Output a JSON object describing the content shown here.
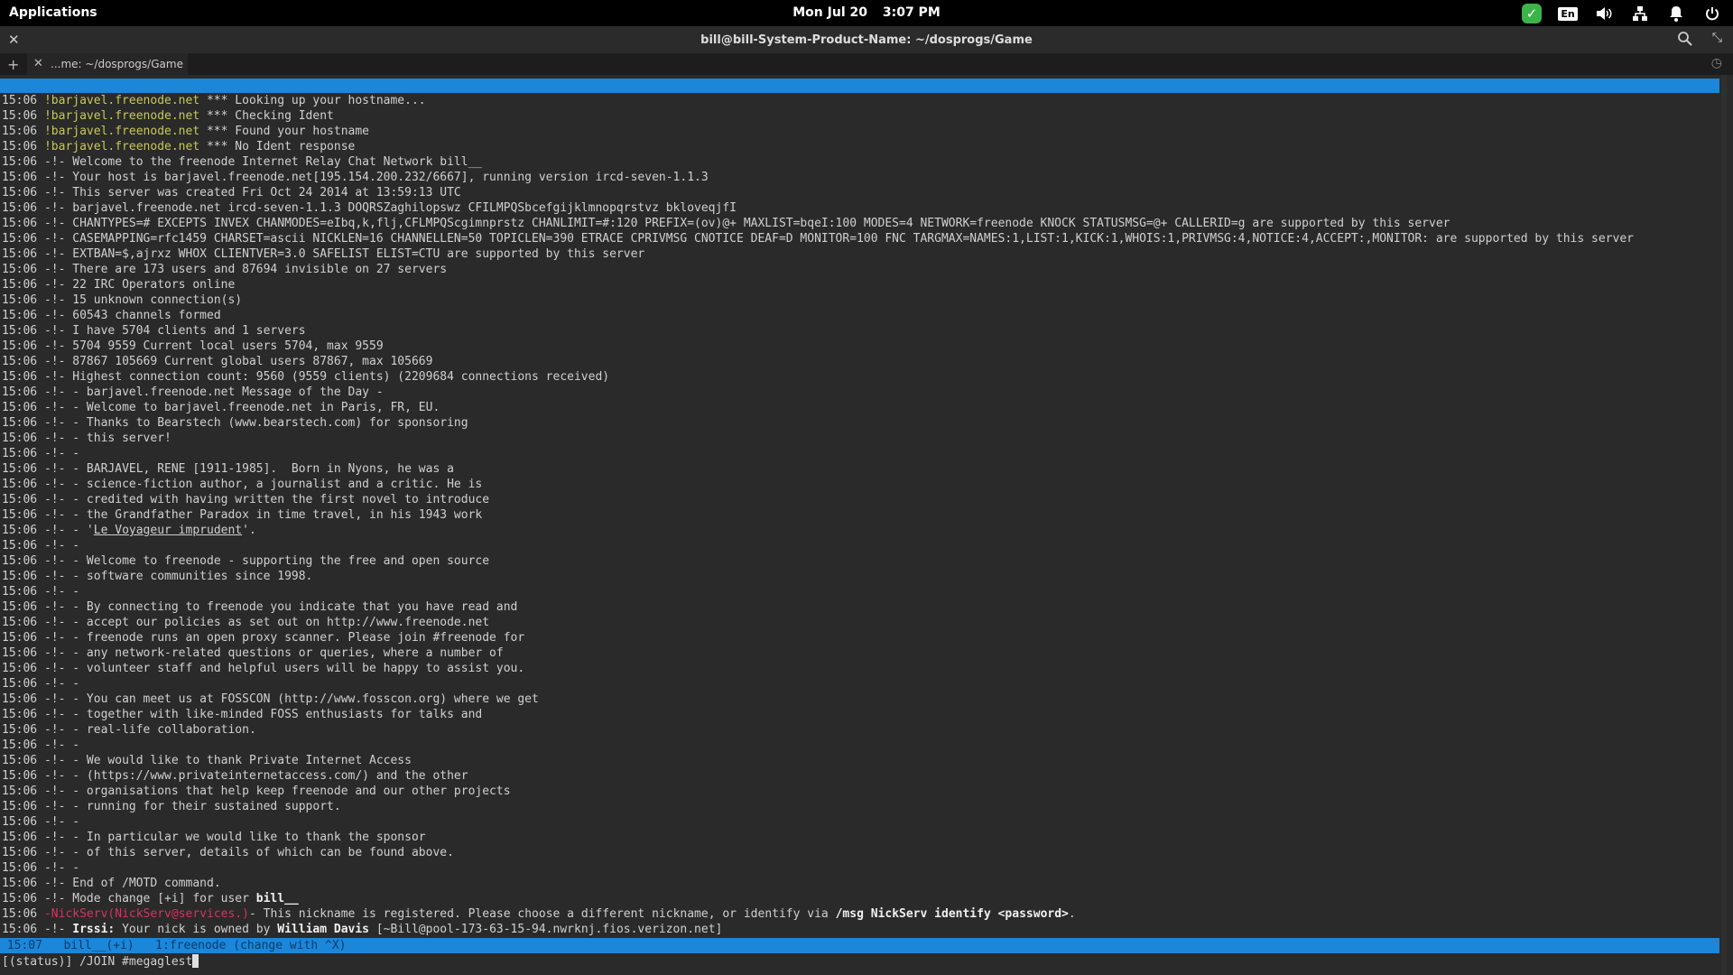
{
  "panel": {
    "applications_label": "Applications",
    "date": "Mon Jul 20",
    "time": "3:07 PM",
    "keyboard_layout": "En"
  },
  "window": {
    "title": "bill@bill-System-Product-Name: ~/dosprogs/Game",
    "tab_label": "...me: ~/dosprogs/Game"
  },
  "terminal": {
    "lines": [
      [
        "15:06 ",
        "!barjavel.freenode.net",
        " *** Looking up your hostname..."
      ],
      [
        "15:06 ",
        "!barjavel.freenode.net",
        " *** Checking Ident"
      ],
      [
        "15:06 ",
        "!barjavel.freenode.net",
        " *** Found your hostname"
      ],
      [
        "15:06 ",
        "!barjavel.freenode.net",
        " *** No Ident response"
      ],
      [
        "15:06 ",
        "-!-",
        " Welcome to the freenode Internet Relay Chat Network bill__"
      ],
      [
        "15:06 ",
        "-!-",
        " Your host is barjavel.freenode.net[195.154.200.232/6667], running version ircd-seven-1.1.3"
      ],
      [
        "15:06 ",
        "-!-",
        " This server was created Fri Oct 24 2014 at 13:59:13 UTC"
      ],
      [
        "15:06 ",
        "-!-",
        " barjavel.freenode.net ircd-seven-1.1.3 DOQRSZaghilopswz CFILMPQSbcefgijklmnopqrstvz bkloveqjfI"
      ],
      [
        "15:06 ",
        "-!-",
        " CHANTYPES=# EXCEPTS INVEX CHANMODES=eIbq,k,flj,CFLMPQScgimnprstz CHANLIMIT=#:120 PREFIX=(ov)@+ MAXLIST=bqeI:100 MODES=4 NETWORK=freenode KNOCK STATUSMSG=@+ CALLERID=g are supported by this server"
      ],
      [
        "15:06 ",
        "-!-",
        " CASEMAPPING=rfc1459 CHARSET=ascii NICKLEN=16 CHANNELLEN=50 TOPICLEN=390 ETRACE CPRIVMSG CNOTICE DEAF=D MONITOR=100 FNC TARGMAX=NAMES:1,LIST:1,KICK:1,WHOIS:1,PRIVMSG:4,NOTICE:4,ACCEPT:,MONITOR: are supported by this server"
      ],
      [
        "15:06 ",
        "-!-",
        " EXTBAN=$,ajrxz WHOX CLIENTVER=3.0 SAFELIST ELIST=CTU are supported by this server"
      ],
      [
        "15:06 ",
        "-!-",
        " There are 173 users and 87694 invisible on 27 servers"
      ],
      [
        "15:06 ",
        "-!-",
        " 22 IRC Operators online"
      ],
      [
        "15:06 ",
        "-!-",
        " 15 unknown connection(s)"
      ],
      [
        "15:06 ",
        "-!-",
        " 60543 channels formed"
      ],
      [
        "15:06 ",
        "-!-",
        " I have 5704 clients and 1 servers"
      ],
      [
        "15:06 ",
        "-!-",
        " 5704 9559 Current local users 5704, max 9559"
      ],
      [
        "15:06 ",
        "-!-",
        " 87867 105669 Current global users 87867, max 105669"
      ],
      [
        "15:06 ",
        "-!-",
        " Highest connection count: 9560 (9559 clients) (2209684 connections received)"
      ],
      [
        "15:06 ",
        "-!-",
        " - barjavel.freenode.net Message of the Day -"
      ],
      [
        "15:06 ",
        "-!-",
        " - Welcome to barjavel.freenode.net in Paris, FR, EU."
      ],
      [
        "15:06 ",
        "-!-",
        " - Thanks to Bearstech (www.bearstech.com) for sponsoring"
      ],
      [
        "15:06 ",
        "-!-",
        " - this server!"
      ],
      [
        "15:06 ",
        "-!-",
        " -"
      ],
      [
        "15:06 ",
        "-!-",
        " - BARJAVEL, RENE [1911-1985].  Born in Nyons, he was a"
      ],
      [
        "15:06 ",
        "-!-",
        " - science-fiction author, a journalist and a critic. He is"
      ],
      [
        "15:06 ",
        "-!-",
        " - credited with having written the first novel to introduce"
      ],
      [
        "15:06 ",
        "-!-",
        " - the Grandfather Paradox in time travel, in his 1943 work"
      ],
      [
        "15:06 ",
        "-!-",
        " - 'Le Voyageur imprudent'."
      ],
      [
        "15:06 ",
        "-!-",
        " -"
      ],
      [
        "15:06 ",
        "-!-",
        " - Welcome to freenode - supporting the free and open source"
      ],
      [
        "15:06 ",
        "-!-",
        " - software communities since 1998."
      ],
      [
        "15:06 ",
        "-!-",
        " -"
      ],
      [
        "15:06 ",
        "-!-",
        " - By connecting to freenode you indicate that you have read and"
      ],
      [
        "15:06 ",
        "-!-",
        " - accept our policies as set out on http://www.freenode.net"
      ],
      [
        "15:06 ",
        "-!-",
        " - freenode runs an open proxy scanner. Please join #freenode for"
      ],
      [
        "15:06 ",
        "-!-",
        " - any network-related questions or queries, where a number of"
      ],
      [
        "15:06 ",
        "-!-",
        " - volunteer staff and helpful users will be happy to assist you."
      ],
      [
        "15:06 ",
        "-!-",
        " -"
      ],
      [
        "15:06 ",
        "-!-",
        " - You can meet us at FOSSCON (http://www.fosscon.org) where we get"
      ],
      [
        "15:06 ",
        "-!-",
        " - together with like-minded FOSS enthusiasts for talks and"
      ],
      [
        "15:06 ",
        "-!-",
        " - real-life collaboration."
      ],
      [
        "15:06 ",
        "-!-",
        " -"
      ],
      [
        "15:06 ",
        "-!-",
        " - We would like to thank Private Internet Access"
      ],
      [
        "15:06 ",
        "-!-",
        " - (https://www.privateinternetaccess.com/) and the other"
      ],
      [
        "15:06 ",
        "-!-",
        " - organisations that help keep freenode and our other projects"
      ],
      [
        "15:06 ",
        "-!-",
        " - running for their sustained support."
      ],
      [
        "15:06 ",
        "-!-",
        " -"
      ],
      [
        "15:06 ",
        "-!-",
        " - In particular we would like to thank the sponsor"
      ],
      [
        "15:06 ",
        "-!-",
        " - of this server, details of which can be found above."
      ],
      [
        "15:06 ",
        "-!-",
        " -"
      ],
      [
        "15:06 ",
        "-!-",
        " End of /MOTD command."
      ]
    ],
    "mode_line": {
      "time": "15:06 ",
      "prefix": "-!-",
      "text": " Mode change [+i] for user ",
      "user": "bill__"
    },
    "nickserv_line": {
      "time": "15:06 ",
      "dash": "-",
      "nick": "NickServ",
      "host": "(NickServ@services.)",
      "text": "- This nickname is registered. Please choose a different nickname, or identify via ",
      "command": "/msg NickServ identify <password>",
      "end": "."
    },
    "irssi_line": {
      "time": "15:06 ",
      "prefix": "-!-",
      "label": " Irssi:",
      "text": " Your nick is owned by ",
      "owner": "William Davis",
      "host": " [~Bill@pool-173-63-15-94.nwrknj.fios.verizon.net]"
    },
    "status_bar": " 15:07   bill__(+i)   1:freenode (change with ^X)",
    "input_prompt": "[(status)] ",
    "input_text": "/JOIN #megaglest"
  }
}
